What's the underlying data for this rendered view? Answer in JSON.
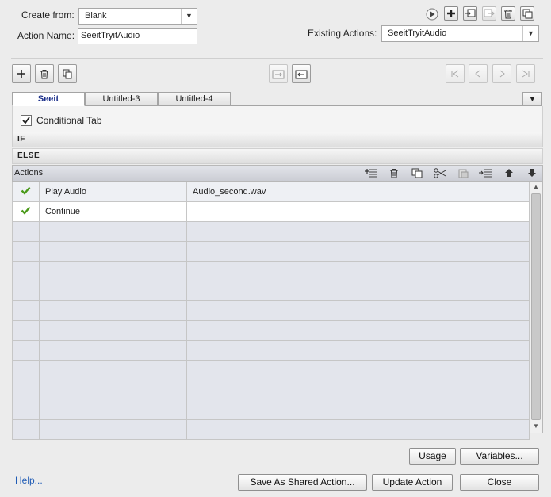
{
  "form": {
    "create_from_label": "Create from:",
    "create_from_value": "Blank",
    "action_name_label": "Action Name:",
    "action_name_value": "SeeitTryitAudio",
    "existing_actions_label": "Existing Actions:",
    "existing_actions_value": "SeeitTryitAudio"
  },
  "tabs": [
    {
      "label": "Seeit",
      "active": true
    },
    {
      "label": "Untitled-3",
      "active": false
    },
    {
      "label": "Untitled-4",
      "active": false
    }
  ],
  "conditional_tab_label": "Conditional Tab",
  "conditional_tab_checked": true,
  "if_label": "IF",
  "else_label": "ELSE",
  "actions_label": "Actions",
  "rows": [
    {
      "checked": true,
      "action": "Play Audio",
      "value": "Audio_second.wav"
    },
    {
      "checked": true,
      "action": "Continue",
      "value": ""
    },
    {
      "checked": false,
      "action": "",
      "value": ""
    },
    {
      "checked": false,
      "action": "",
      "value": ""
    },
    {
      "checked": false,
      "action": "",
      "value": ""
    },
    {
      "checked": false,
      "action": "",
      "value": ""
    },
    {
      "checked": false,
      "action": "",
      "value": ""
    },
    {
      "checked": false,
      "action": "",
      "value": ""
    },
    {
      "checked": false,
      "action": "",
      "value": ""
    },
    {
      "checked": false,
      "action": "",
      "value": ""
    },
    {
      "checked": false,
      "action": "",
      "value": ""
    },
    {
      "checked": false,
      "action": "",
      "value": ""
    },
    {
      "checked": false,
      "action": "",
      "value": ""
    }
  ],
  "buttons": {
    "usage": "Usage",
    "variables": "Variables...",
    "save_shared": "Save As Shared Action...",
    "update": "Update Action",
    "close": "Close"
  },
  "help_link": "Help...",
  "colors": {
    "accent": "#1b2f8a",
    "check": "#4a9a1a",
    "link": "#1f5bb5"
  }
}
